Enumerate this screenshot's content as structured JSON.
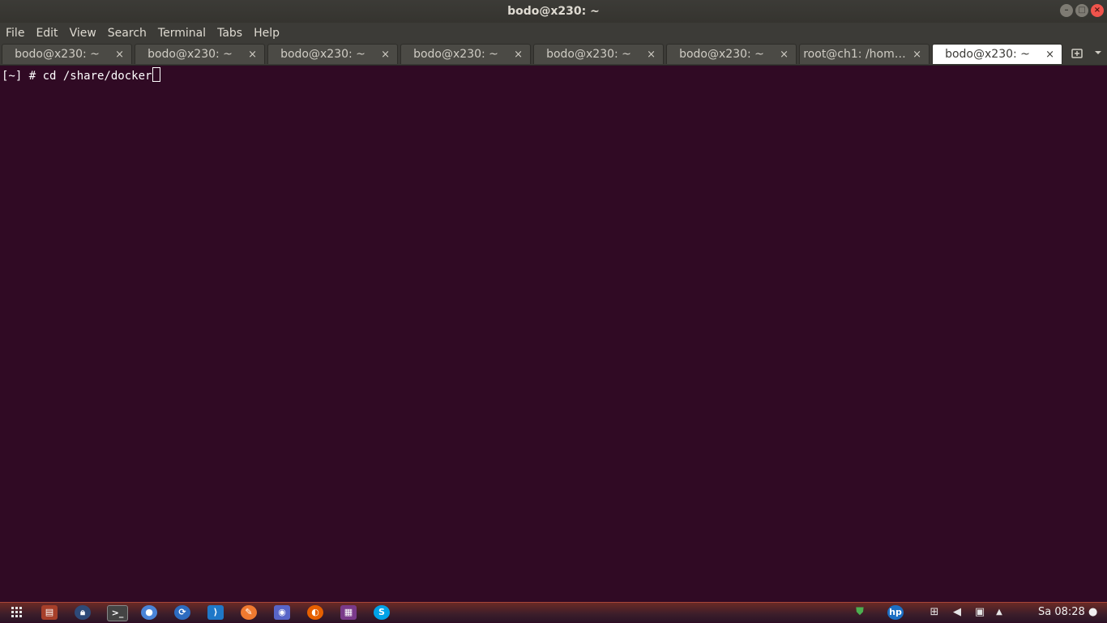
{
  "window": {
    "title": "bodo@x230: ~"
  },
  "menu": {
    "items": [
      "File",
      "Edit",
      "View",
      "Search",
      "Terminal",
      "Tabs",
      "Help"
    ]
  },
  "tabs": [
    {
      "label": "bodo@x230: ~",
      "active": false
    },
    {
      "label": "bodo@x230: ~",
      "active": false
    },
    {
      "label": "bodo@x230: ~",
      "active": false
    },
    {
      "label": "bodo@x230: ~",
      "active": false
    },
    {
      "label": "bodo@x230: ~",
      "active": false
    },
    {
      "label": "bodo@x230: ~",
      "active": false
    },
    {
      "label": "root@ch1: /hom…",
      "active": false
    },
    {
      "label": "bodo@x230: ~",
      "active": true
    }
  ],
  "terminal": {
    "line": "[~] # cd /share/docker",
    "background": "#300a24",
    "foreground": "#ffffff"
  },
  "taskbar": {
    "apps": [
      {
        "name": "apps-grid-icon"
      },
      {
        "name": "file-manager-icon"
      },
      {
        "name": "keepass-icon"
      },
      {
        "name": "terminal-icon"
      },
      {
        "name": "chromium-icon"
      },
      {
        "name": "remmina-icon"
      },
      {
        "name": "vscode-icon"
      },
      {
        "name": "sublime-icon"
      },
      {
        "name": "discord-icon"
      },
      {
        "name": "firefox-icon"
      },
      {
        "name": "video-editor-icon"
      },
      {
        "name": "skype-icon"
      }
    ],
    "clock": "Sa 08:28"
  },
  "icons": {
    "close": "×",
    "minimize": "–",
    "maximize": "□"
  }
}
